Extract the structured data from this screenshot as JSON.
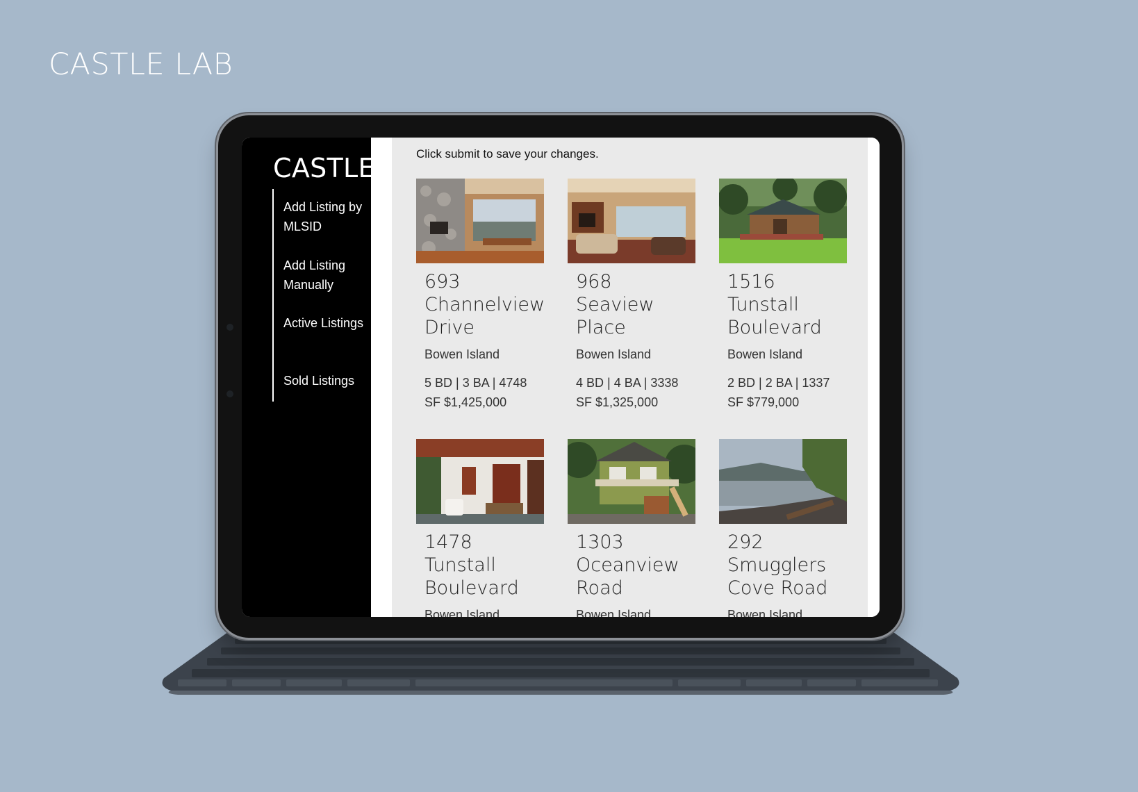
{
  "page_title": "CASTLE LAB",
  "app": {
    "logo": "CASTLE",
    "nav": [
      {
        "label": "Add Listing by MLSID"
      },
      {
        "label": "Add Listing Manually"
      },
      {
        "label": "Active Listings"
      },
      {
        "label": "Sold Listings"
      }
    ],
    "notice": "Click submit to save your changes.",
    "listings": [
      {
        "title": "693 Channelview Drive",
        "location": "Bowen Island",
        "specs": "5 BD | 3 BA | 4748 SF $1,425,000"
      },
      {
        "title": "968 Seaview Place",
        "location": "Bowen Island",
        "specs": "4 BD | 4 BA | 3338 SF $1,325,000"
      },
      {
        "title": "1516 Tunstall Boulevard",
        "location": "Bowen Island",
        "specs": "2 BD | 2 BA | 1337 SF $779,000"
      },
      {
        "title": "1478 Tunstall Boulevard",
        "location": "Bowen Island",
        "specs": ""
      },
      {
        "title": "1303 Oceanview Road",
        "location": "Bowen Island",
        "specs": ""
      },
      {
        "title": "292 Smugglers Cove Road",
        "location": "Bowen Island",
        "specs": ""
      }
    ]
  },
  "colors": {
    "background": "#a6b8ca",
    "sidebar": "#000000",
    "content": "#eaeaea"
  }
}
